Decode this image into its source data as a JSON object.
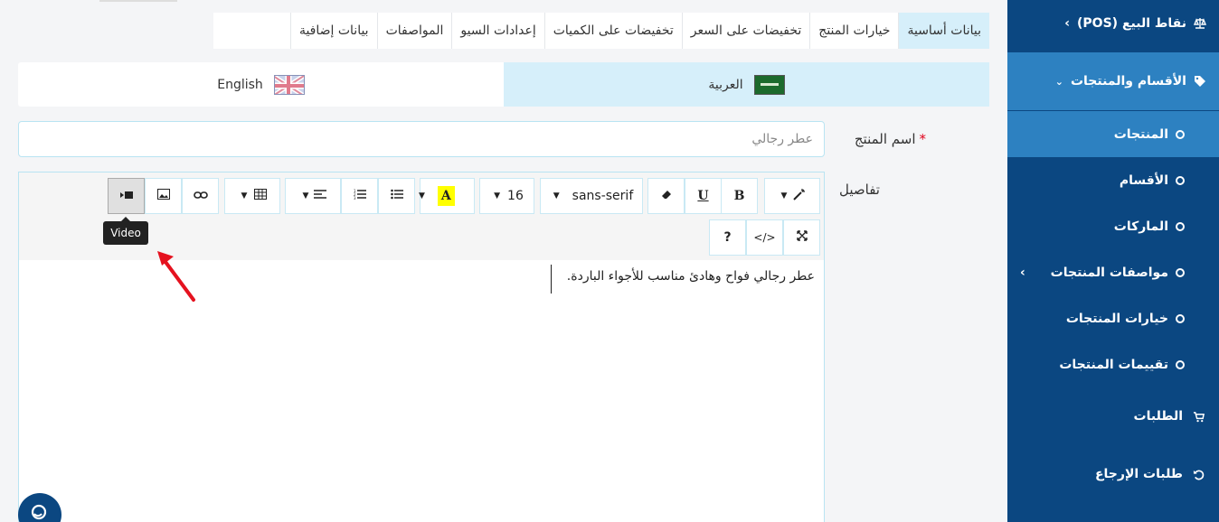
{
  "sidebar": {
    "pos_label": "نقاط البيع (POS)",
    "categories_label": "الأقسام والمنتجات",
    "sub_items": [
      {
        "label": "المنتجات",
        "active": true
      },
      {
        "label": "الأقسام",
        "active": false
      },
      {
        "label": "الماركات",
        "active": false
      },
      {
        "label": "مواصفات المنتجات",
        "active": false
      },
      {
        "label": "خيارات المنتجات",
        "active": false
      },
      {
        "label": "تقييمات المنتجات",
        "active": false
      }
    ],
    "orders_label": "الطلبات",
    "returns_label": "طلبات الإرجاع"
  },
  "tabs": [
    {
      "label": "بيانات أساسية",
      "active": true
    },
    {
      "label": "خيارات المنتج",
      "active": false
    },
    {
      "label": "تخفيضات على السعر",
      "active": false
    },
    {
      "label": "تخفيضات على الكميات",
      "active": false
    },
    {
      "label": "إعدادات السيو",
      "active": false
    },
    {
      "label": "المواصفات",
      "active": false
    },
    {
      "label": "بيانات إضافية",
      "active": false
    }
  ],
  "languages": {
    "arabic": "العربية",
    "english": "English"
  },
  "form": {
    "name_label": "اسم المنتج",
    "name_required_mark": "*",
    "name_value": "عطر رجالي",
    "details_label": "تفاصيل"
  },
  "editor": {
    "font_name": "sans-serif",
    "font_size": "16",
    "bold_label": "B",
    "underline_label": "U",
    "color_label": "A",
    "help_label": "?",
    "code_label": "</>",
    "tooltip": "Video",
    "content": "عطر رجالي فواح وهادئ مناسب للأجواء الباردة."
  },
  "colors": {
    "sidebar_bg": "#0b4781",
    "sidebar_active": "#2d81c1",
    "tab_active": "#d6effa",
    "highlight_yellow": "#ffff00"
  }
}
